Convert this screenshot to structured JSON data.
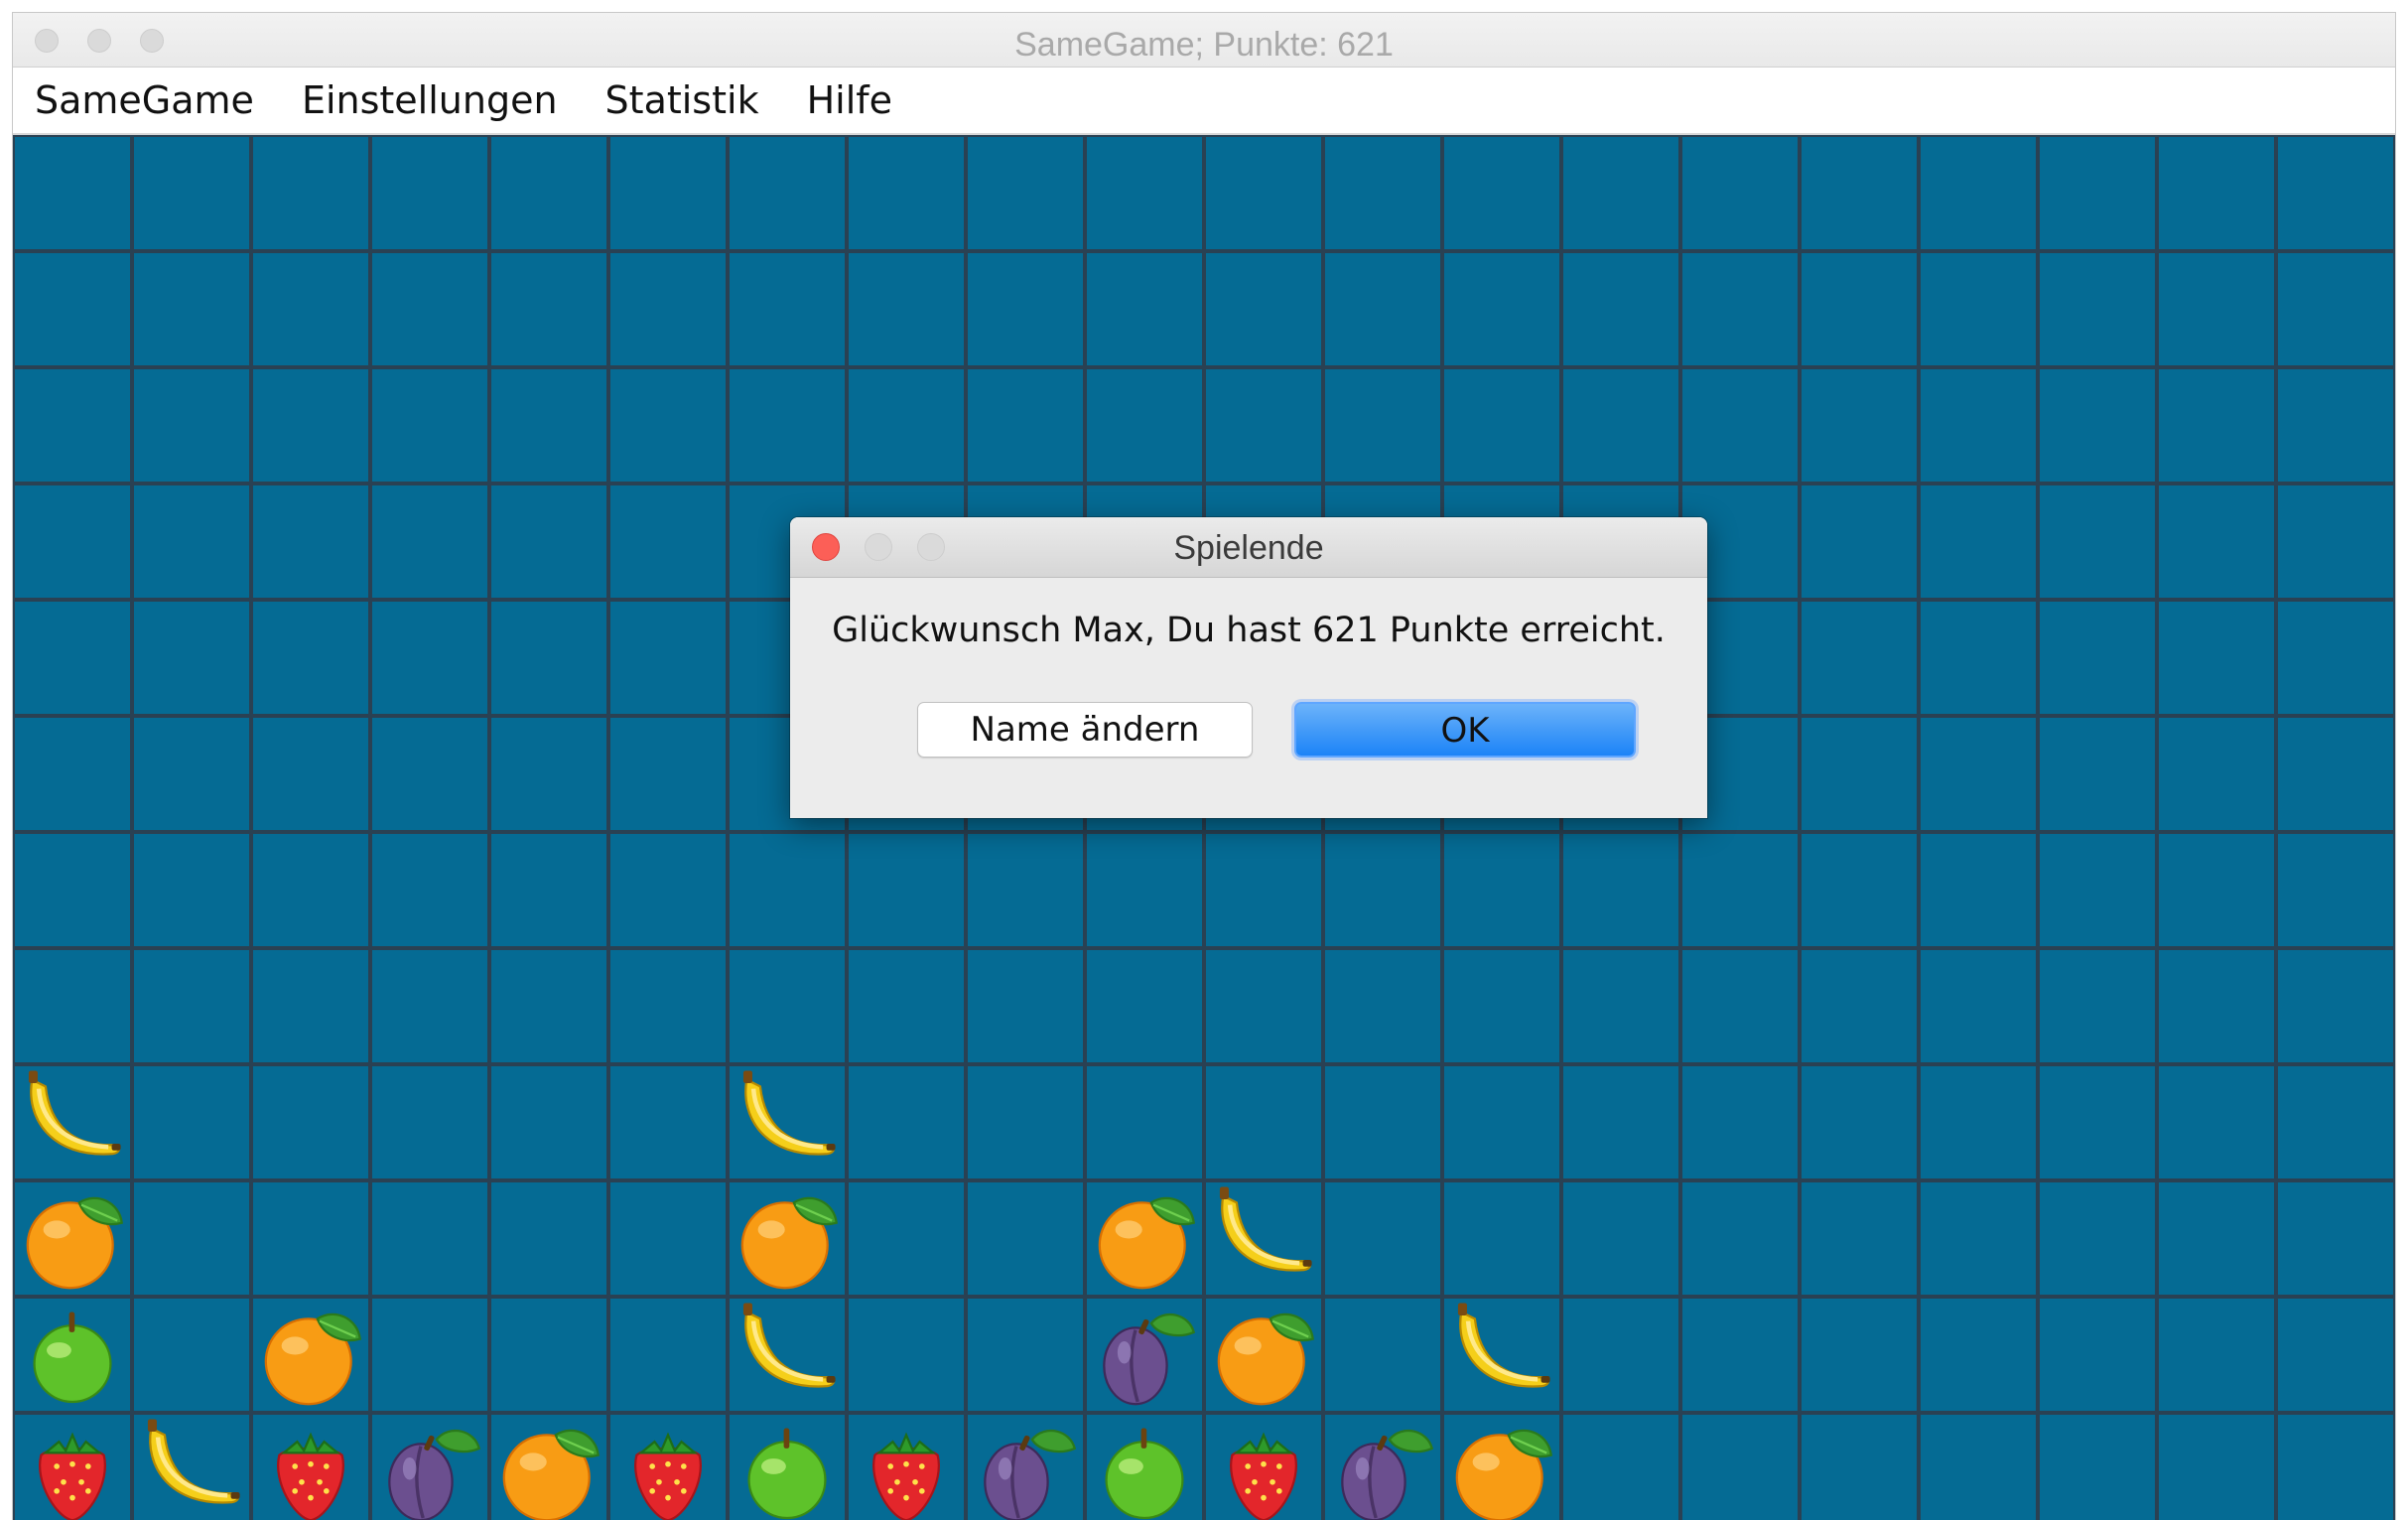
{
  "window": {
    "title": "SameGame; Punkte: 621"
  },
  "menu": {
    "items": [
      "SameGame",
      "Einstellungen",
      "Statistik",
      "Hilfe"
    ]
  },
  "board": {
    "columns": 20,
    "rows": 12,
    "background_color": "#056b94",
    "grid_color": "#2a4153",
    "tiles": [
      {
        "row": 8,
        "col": 0,
        "fruit": "banana"
      },
      {
        "row": 8,
        "col": 6,
        "fruit": "banana"
      },
      {
        "row": 9,
        "col": 0,
        "fruit": "orange"
      },
      {
        "row": 9,
        "col": 6,
        "fruit": "orange"
      },
      {
        "row": 9,
        "col": 9,
        "fruit": "orange"
      },
      {
        "row": 9,
        "col": 10,
        "fruit": "banana"
      },
      {
        "row": 10,
        "col": 0,
        "fruit": "apple"
      },
      {
        "row": 10,
        "col": 2,
        "fruit": "orange"
      },
      {
        "row": 10,
        "col": 6,
        "fruit": "banana"
      },
      {
        "row": 10,
        "col": 9,
        "fruit": "plum"
      },
      {
        "row": 10,
        "col": 10,
        "fruit": "orange"
      },
      {
        "row": 10,
        "col": 12,
        "fruit": "banana"
      },
      {
        "row": 11,
        "col": 0,
        "fruit": "strawberry"
      },
      {
        "row": 11,
        "col": 1,
        "fruit": "banana"
      },
      {
        "row": 11,
        "col": 2,
        "fruit": "strawberry"
      },
      {
        "row": 11,
        "col": 3,
        "fruit": "plum"
      },
      {
        "row": 11,
        "col": 4,
        "fruit": "orange"
      },
      {
        "row": 11,
        "col": 5,
        "fruit": "strawberry"
      },
      {
        "row": 11,
        "col": 6,
        "fruit": "apple"
      },
      {
        "row": 11,
        "col": 7,
        "fruit": "strawberry"
      },
      {
        "row": 11,
        "col": 8,
        "fruit": "plum"
      },
      {
        "row": 11,
        "col": 9,
        "fruit": "apple"
      },
      {
        "row": 11,
        "col": 10,
        "fruit": "strawberry"
      },
      {
        "row": 11,
        "col": 11,
        "fruit": "plum"
      },
      {
        "row": 11,
        "col": 12,
        "fruit": "orange"
      }
    ]
  },
  "dialog": {
    "title": "Spielende",
    "message": "Glückwunsch Max, Du hast 621 Punkte erreicht.",
    "buttons": {
      "change_name": "Name ändern",
      "ok": "OK"
    }
  }
}
